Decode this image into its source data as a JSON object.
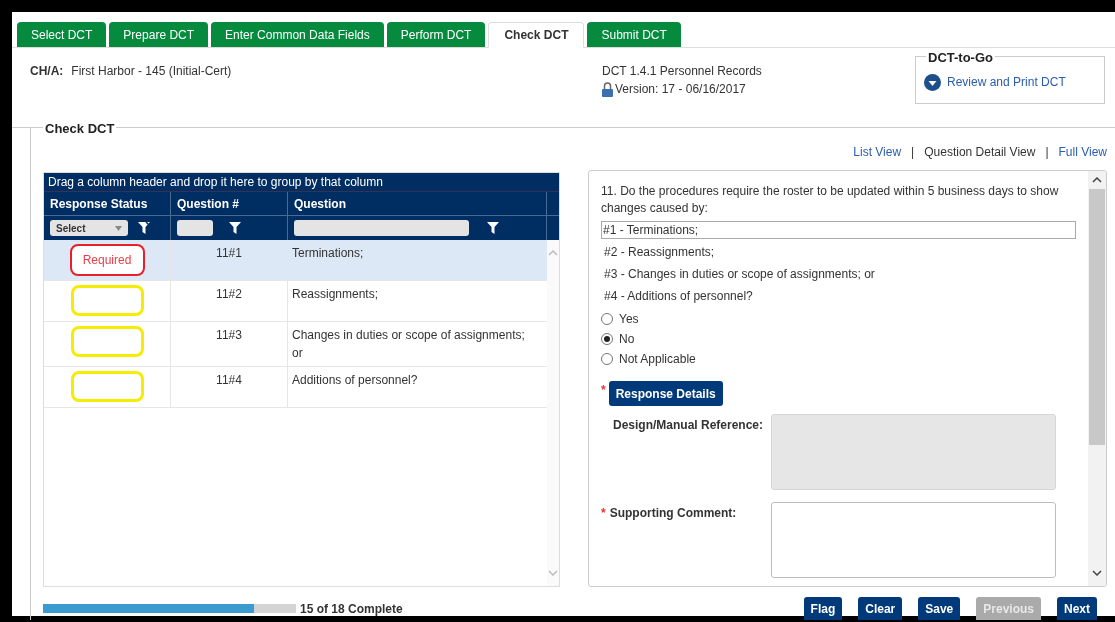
{
  "tabs": [
    {
      "label": "Select DCT",
      "selected": false
    },
    {
      "label": "Prepare DCT",
      "selected": false
    },
    {
      "label": "Enter Common Data Fields",
      "selected": false
    },
    {
      "label": "Perform DCT",
      "selected": false
    },
    {
      "label": "Check DCT",
      "selected": true
    },
    {
      "label": "Submit DCT",
      "selected": false
    }
  ],
  "header": {
    "cha_label": "CH/A:",
    "cha_value": "First Harbor - 145 (Initial-Cert)",
    "dct_title": "DCT 1.4.1 Personnel Records",
    "version": "Version: 17 - 06/16/2017"
  },
  "dct_to_go": {
    "title": "DCT-to-Go",
    "link": "Review and Print DCT"
  },
  "section_title": "Check DCT",
  "view_separator": "|",
  "views": [
    {
      "label": "List View",
      "selected": false
    },
    {
      "label": "Question Detail View",
      "selected": true
    },
    {
      "label": "Full View",
      "selected": false
    }
  ],
  "grid": {
    "group_hint": "Drag a column header and drop it here to group by that column",
    "columns": [
      "Response Status",
      "Question #",
      "Question"
    ],
    "status_filter": "Select",
    "rows": [
      {
        "status": {
          "kind": "required",
          "text": "Required"
        },
        "number": "11#1",
        "question": "Terminations;",
        "selected": true
      },
      {
        "status": {
          "kind": "pending"
        },
        "number": "11#2",
        "question": "Reassignments;",
        "selected": false
      },
      {
        "status": {
          "kind": "pending"
        },
        "number": "11#3",
        "question": "Changes in duties or scope of assignments; or",
        "selected": false
      },
      {
        "status": {
          "kind": "pending"
        },
        "number": "11#4",
        "question": "Additions of personnel?",
        "selected": false
      }
    ]
  },
  "detail": {
    "required_mark": "*",
    "question": "11. Do the procedures require the roster to be updated within 5 business days to show changes caused by:",
    "parts": [
      {
        "text": "#1 - Terminations;",
        "selected": true
      },
      {
        "text": "#2 - Reassignments;",
        "selected": false
      },
      {
        "text": "#3 - Changes in duties or scope of assignments; or",
        "selected": false
      },
      {
        "text": "#4 - Additions of personnel?",
        "selected": false
      }
    ],
    "options": [
      {
        "label": "Yes",
        "selected": false
      },
      {
        "label": "No",
        "selected": true
      },
      {
        "label": "Not Applicable",
        "selected": false
      }
    ],
    "response_button": {
      "label": "Response Details",
      "required": true
    },
    "fields": [
      {
        "label": "Design/Manual Reference:",
        "required": false,
        "disabled": true
      },
      {
        "label": "Supporting Comment:",
        "required": true,
        "disabled": false
      }
    ]
  },
  "progress": {
    "level": 0.833,
    "text": "15 of 18 Complete"
  },
  "buttons": [
    {
      "label": "Flag",
      "disabled": false
    },
    {
      "label": "Clear",
      "disabled": false
    },
    {
      "label": "Save",
      "disabled": false
    },
    {
      "label": "Previous",
      "disabled": true
    },
    {
      "label": "Next",
      "disabled": false
    }
  ]
}
